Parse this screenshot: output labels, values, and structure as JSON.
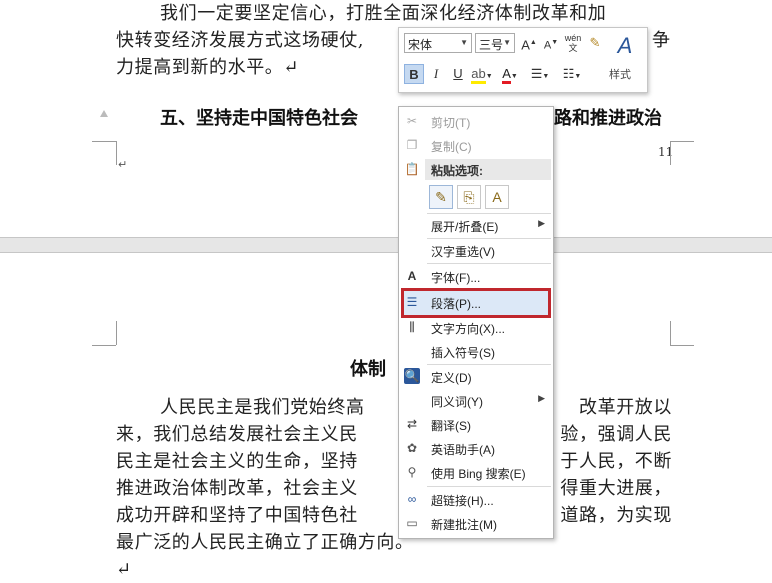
{
  "document": {
    "para1_lines": [
      "我们一定要坚定信心，打胜全面深化经济体制改革和加",
      "快转变经济发展方式这场硬仗,",
      "力提高到新的水平。↵"
    ],
    "para1_right_fragment": "争",
    "heading1_left": "五、坚持走中国特色社会",
    "heading1_right": "路和推进政治",
    "page_number": "11",
    "heading2_fragment": "体制",
    "para2_left": [
      "人民民主是我们党始终高",
      "来，我们总结发展社会主义民",
      "民主是社会主义的生命，坚持",
      "推进政治体制改革，社会主义",
      "成功开辟和坚持了中国特色社",
      "最广泛的人民民主确立了正确方向。↵"
    ],
    "para2_right": [
      "改革开放以",
      "验，强调人民",
      "于人民，不断",
      "得重大进展，",
      "道路，为实现",
      ""
    ],
    "return_mark": "↵"
  },
  "mini_toolbar": {
    "font_name": "宋体",
    "font_size": "三号",
    "bold": "B",
    "italic": "I",
    "underline": "U",
    "styles_label": "样式",
    "phonetic": "wén"
  },
  "context_menu": {
    "items": [
      {
        "label": "剪切(T)",
        "icon": "scissors-icon",
        "disabled": true
      },
      {
        "label": "复制(C)",
        "icon": "copy-icon",
        "disabled": true
      },
      {
        "label": "展开/折叠(E)",
        "submenu": true
      },
      {
        "label": "汉字重选(V)"
      },
      {
        "label": "字体(F)...",
        "icon": "font-icon"
      },
      {
        "label": "段落(P)...",
        "icon": "paragraph-icon",
        "highlighted": true
      },
      {
        "label": "文字方向(X)...",
        "icon": "text-direction-icon"
      },
      {
        "label": "插入符号(S)"
      },
      {
        "label": "定义(D)",
        "icon": "define-icon"
      },
      {
        "label": "同义词(Y)",
        "submenu": true
      },
      {
        "label": "翻译(S)",
        "icon": "translate-icon"
      },
      {
        "label": "英语助手(A)",
        "icon": "english-assistant-icon"
      },
      {
        "label": "使用 Bing 搜索(E)",
        "icon": "bing-search-icon"
      },
      {
        "label": "超链接(H)...",
        "icon": "hyperlink-icon"
      },
      {
        "label": "新建批注(M)",
        "icon": "new-comment-icon"
      }
    ],
    "paste_header": "粘贴选项:",
    "highlight_color": "#c0272d"
  }
}
